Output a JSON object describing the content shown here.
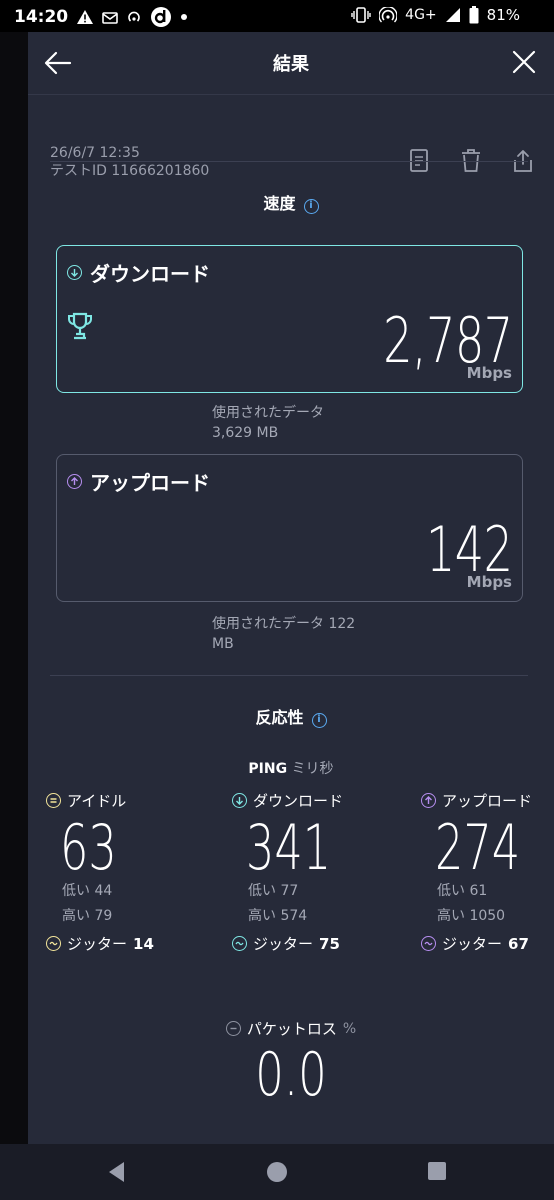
{
  "status_bar": {
    "time": "14:20",
    "network": "4G+",
    "battery": "81%"
  },
  "header": {
    "title": "結果"
  },
  "meta": {
    "datetime": "26/6/7 12:35",
    "test_id": "テストID 11666201860"
  },
  "speed": {
    "section_title": "速度",
    "download": {
      "label": "ダウンロード",
      "value": "2,787",
      "unit": "Mbps",
      "data_used_line1": "使用されたデータ",
      "data_used_line2": "3,629 MB"
    },
    "upload": {
      "label": "アップロード",
      "value": "142",
      "unit": "Mbps",
      "data_used_line1": "使用されたデータ 122",
      "data_used_line2": "MB"
    }
  },
  "responsiveness": {
    "section_title": "反応性",
    "ping_label": "PING",
    "ping_unit": "ミリ秒",
    "idle": {
      "label": "アイドル",
      "value": "63",
      "low": "低い 44",
      "high": "高い 79",
      "jitter_label": "ジッター",
      "jitter_value": "14"
    },
    "download": {
      "label": "ダウンロード",
      "value": "341",
      "low": "低い 77",
      "high": "高い 574",
      "jitter_label": "ジッター",
      "jitter_value": "75"
    },
    "upload": {
      "label": "アップロード",
      "value": "274",
      "low": "低い 61",
      "high": "高い 1050",
      "jitter_label": "ジッター",
      "jitter_value": "67"
    }
  },
  "packet_loss": {
    "label": "パケットロス",
    "unit": "%",
    "value": "0.0"
  },
  "colors": {
    "background": "#262a39",
    "download_accent": "#7fe7e4",
    "upload_accent": "#b68ef0",
    "idle_accent": "#f2e49a",
    "info_blue": "#5aa9f0"
  }
}
